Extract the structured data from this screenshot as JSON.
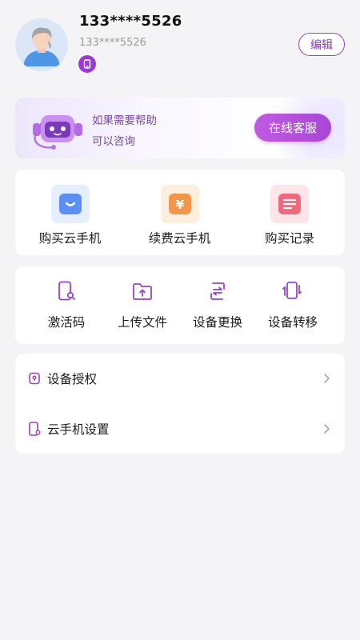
{
  "profile": {
    "username": "133****5526",
    "subname": "133****5526",
    "edit_label": "编辑"
  },
  "service": {
    "line1": "如果需要帮助",
    "line2": "可以咨询",
    "button_label": "在线客服"
  },
  "services_grid": [
    {
      "label": "购买云手机",
      "icon": "bag-icon",
      "color": "#5b8ff0"
    },
    {
      "label": "续费云手机",
      "icon": "yen-icon",
      "color": "#f29a4a"
    },
    {
      "label": "购买记录",
      "icon": "list-icon",
      "color": "#ef6b7e"
    }
  ],
  "functions": [
    {
      "label": "激活码",
      "icon": "activation-code-icon"
    },
    {
      "label": "上传文件",
      "icon": "upload-folder-icon"
    },
    {
      "label": "设备更换",
      "icon": "swap-icon"
    },
    {
      "label": "设备转移",
      "icon": "transfer-icon"
    }
  ],
  "menu": [
    {
      "label": "设备授权",
      "icon": "lock-icon"
    },
    {
      "label": "云手机设置",
      "icon": "phone-settings-icon"
    }
  ],
  "colors": {
    "accent": "#9b43c8",
    "background": "#f4f4f6"
  }
}
